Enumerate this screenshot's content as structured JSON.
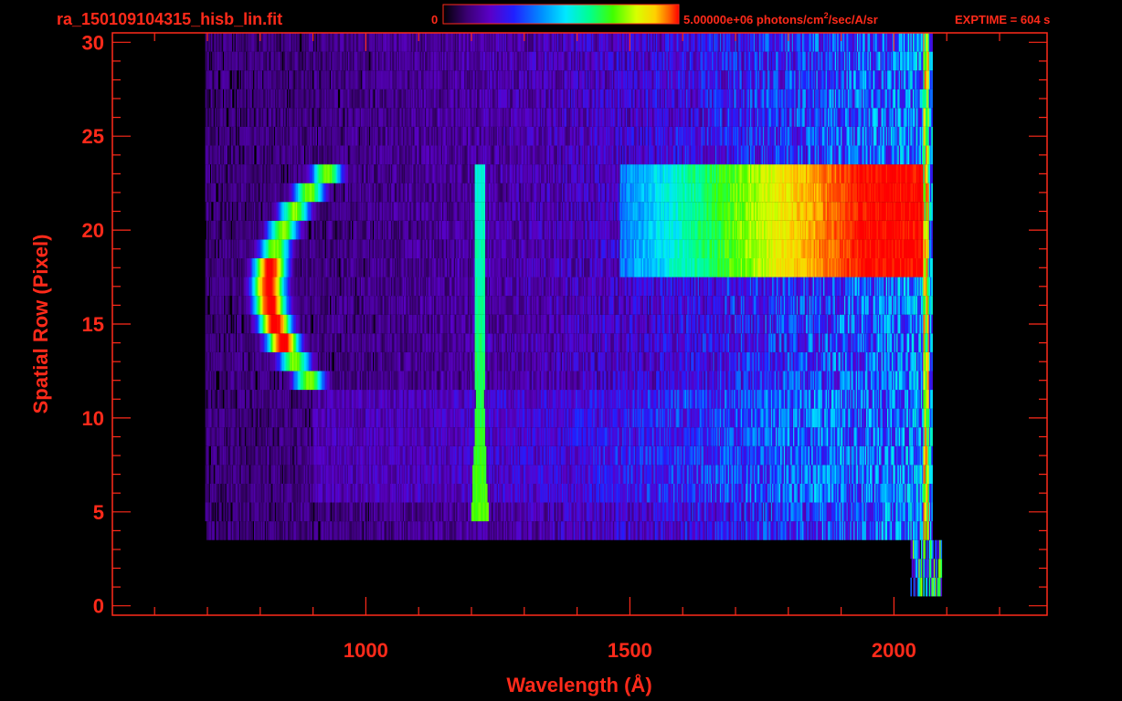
{
  "header": {
    "filename": "ra_150109104315_hisb_lin.fit",
    "colorbar_min_label": "0",
    "colorbar_max_label": "5.00000e+06 photons/cm",
    "colorbar_units_sup": "2",
    "colorbar_units_rest": "/sec/A/sr",
    "exptime_label": "EXPTIME = 604 s"
  },
  "colors": {
    "axis": "#ff2a1a",
    "background": "#000000",
    "colormap": [
      "#000000",
      "#3a0072",
      "#5a00c8",
      "#2020ff",
      "#0090ff",
      "#00e8ff",
      "#00ff90",
      "#40ff00",
      "#d8ff00",
      "#ffd000",
      "#ff6000",
      "#ff0000"
    ]
  },
  "chart_data": {
    "type": "heatmap",
    "title": "ra_150109104315_hisb_lin.fit",
    "xlabel": "Wavelength (Å)",
    "ylabel": "Spatial Row (Pixel)",
    "xlim": [
      520,
      2290
    ],
    "ylim": [
      -0.5,
      30.5
    ],
    "x_ticks": [
      1000,
      1500,
      2000
    ],
    "x_tick_labels": [
      "1000",
      "1500",
      "2000"
    ],
    "x_minor_step": 100,
    "y_ticks": [
      0,
      5,
      10,
      15,
      20,
      25,
      30
    ],
    "y_tick_labels": [
      "0",
      "5",
      "10",
      "15",
      "20",
      "25",
      "30"
    ],
    "y_minor_step": 1,
    "colorbar": {
      "min": 0,
      "max": 5000000,
      "units": "photons/cm^2/sec/A/sr",
      "scale": "linear"
    },
    "grid": false,
    "rows_with_data": [
      4,
      30
    ],
    "wavelength_coverage": [
      695,
      2065
    ],
    "features": [
      {
        "kind": "curved arc",
        "x_range": [
          790,
          960
        ],
        "rows": [
          12,
          23
        ],
        "peak_rows": [
          14,
          18
        ],
        "peak_intensity": 1.0
      },
      {
        "kind": "vertical line",
        "x_center": 1215,
        "rows": [
          5,
          23
        ],
        "intensity_bottom": 0.62,
        "intensity_top": 0.46
      },
      {
        "kind": "band",
        "x_range": [
          1600,
          2055
        ],
        "rows": [
          18,
          23
        ],
        "intensity": 0.6
      },
      {
        "kind": "edge column",
        "x_center": 2060,
        "rows": [
          4,
          30
        ],
        "intensity": 0.85
      }
    ]
  }
}
